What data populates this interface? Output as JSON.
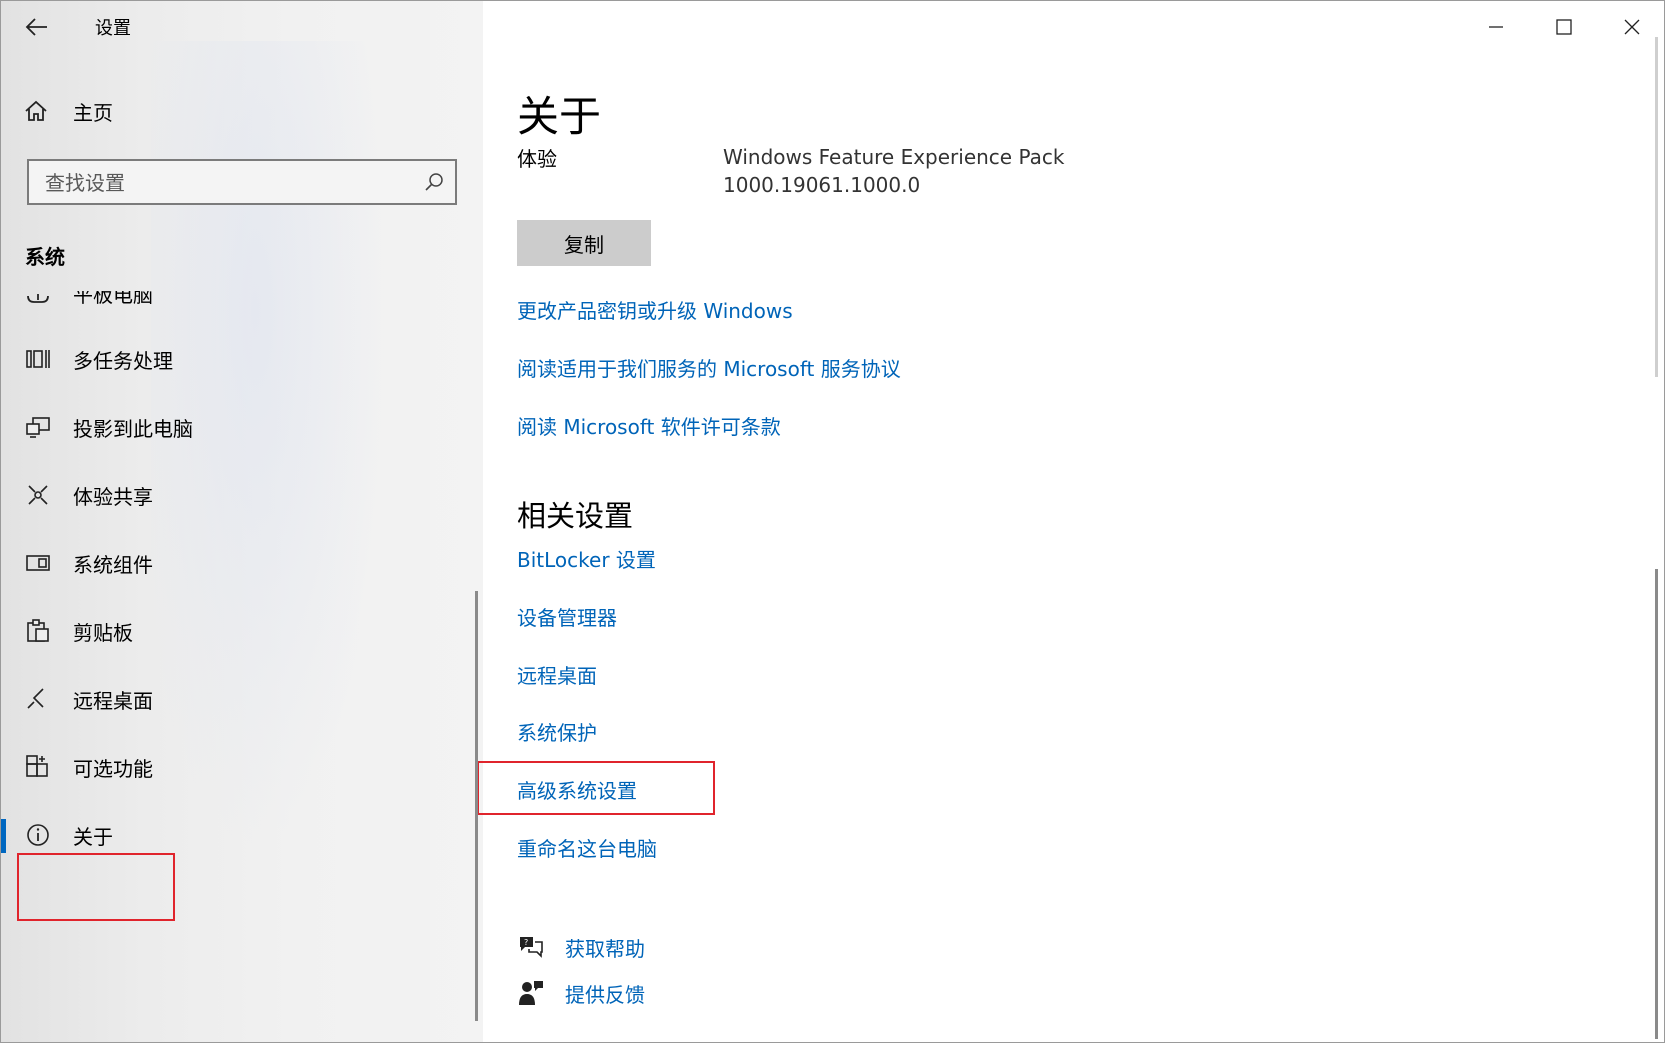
{
  "window": {
    "app_title": "设置",
    "controls": {
      "minimize": "minimize-icon",
      "maximize": "maximize-icon",
      "close": "close-icon"
    }
  },
  "sidebar": {
    "home_label": "主页",
    "search": {
      "placeholder": "查找设置",
      "value": ""
    },
    "section_label": "系统",
    "items": [
      {
        "label": "平板电脑",
        "icon": "tablet-icon"
      },
      {
        "label": "多任务处理",
        "icon": "multitasking-icon"
      },
      {
        "label": "投影到此电脑",
        "icon": "projecting-icon"
      },
      {
        "label": "体验共享",
        "icon": "shared-experiences-icon"
      },
      {
        "label": "系统组件",
        "icon": "system-components-icon"
      },
      {
        "label": "剪贴板",
        "icon": "clipboard-icon"
      },
      {
        "label": "远程桌面",
        "icon": "remote-desktop-icon"
      },
      {
        "label": "可选功能",
        "icon": "optional-features-icon"
      },
      {
        "label": "关于",
        "icon": "info-icon",
        "active": true
      }
    ]
  },
  "main": {
    "page_title": "关于",
    "experience": {
      "label": "体验",
      "value_line1": "Windows Feature Experience Pack",
      "value_line2": "1000.19061.1000.0"
    },
    "copy_button": "复制",
    "links": [
      "更改产品密钥或升级 Windows",
      "阅读适用于我们服务的 Microsoft 服务协议",
      "阅读 Microsoft 软件许可条款"
    ],
    "related": {
      "title": "相关设置",
      "links": [
        "BitLocker 设置",
        "设备管理器",
        "远程桌面",
        "系统保护",
        "高级系统设置",
        "重命名这台电脑"
      ]
    },
    "help": {
      "get_help": "获取帮助",
      "feedback": "提供反馈"
    }
  },
  "highlight_color": "#e0242c",
  "accent_color": "#0067c0"
}
